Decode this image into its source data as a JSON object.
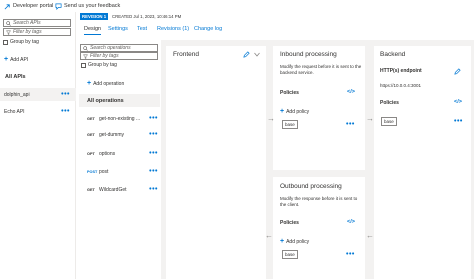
{
  "topbar": {
    "developer_portal": "Developer portal",
    "feedback": "Send us your feedback"
  },
  "sidebar": {
    "search_placeholder": "Search APIs",
    "filter_placeholder": "Filter by tags",
    "group_by_tag": "Group by tag",
    "add_api": "Add API",
    "all_apis": "All APIs",
    "apis": [
      {
        "name": "dolphin_api",
        "selected": true
      },
      {
        "name": "Echo API",
        "selected": false
      }
    ]
  },
  "revision": {
    "badge": "REVISION 1",
    "created": "CREATED Jul 1, 2023, 10:46:14 PM"
  },
  "tabs": [
    {
      "label": "Design",
      "active": true
    },
    {
      "label": "Settings",
      "active": false
    },
    {
      "label": "Test",
      "active": false
    },
    {
      "label": "Revisions (1)",
      "active": false
    },
    {
      "label": "Change log",
      "active": false
    }
  ],
  "operations": {
    "search_placeholder": "Search operations",
    "filter_placeholder": "Filter by tags",
    "group_by_tag": "Group by tag",
    "add_operation": "Add operation",
    "all_operations": "All operations",
    "items": [
      {
        "verb": "GET",
        "name": "get-non-existing ..."
      },
      {
        "verb": "GET",
        "name": "get-dummy"
      },
      {
        "verb": "OPT",
        "name": "options"
      },
      {
        "verb": "POST",
        "name": "post"
      },
      {
        "verb": "GET",
        "name": "WildcardGet"
      }
    ]
  },
  "frontend": {
    "title": "Frontend"
  },
  "inbound": {
    "title": "Inbound processing",
    "description": "Modify the request before it is sent to the backend service.",
    "policies_label": "Policies",
    "add_policy": "Add policy",
    "base": "base"
  },
  "outbound": {
    "title": "Outbound processing",
    "description": "Modify the response before it is sent to the client.",
    "policies_label": "Policies",
    "add_policy": "Add policy",
    "base": "base"
  },
  "backend": {
    "title": "Backend",
    "endpoint_label": "HTTP(s) endpoint",
    "endpoint_value": "https://10.0.0.4:3001",
    "policies_label": "Policies"
  },
  "colors": {
    "accent": "#0078d4",
    "canvas": "#f3f2f1",
    "text": "#323130"
  }
}
